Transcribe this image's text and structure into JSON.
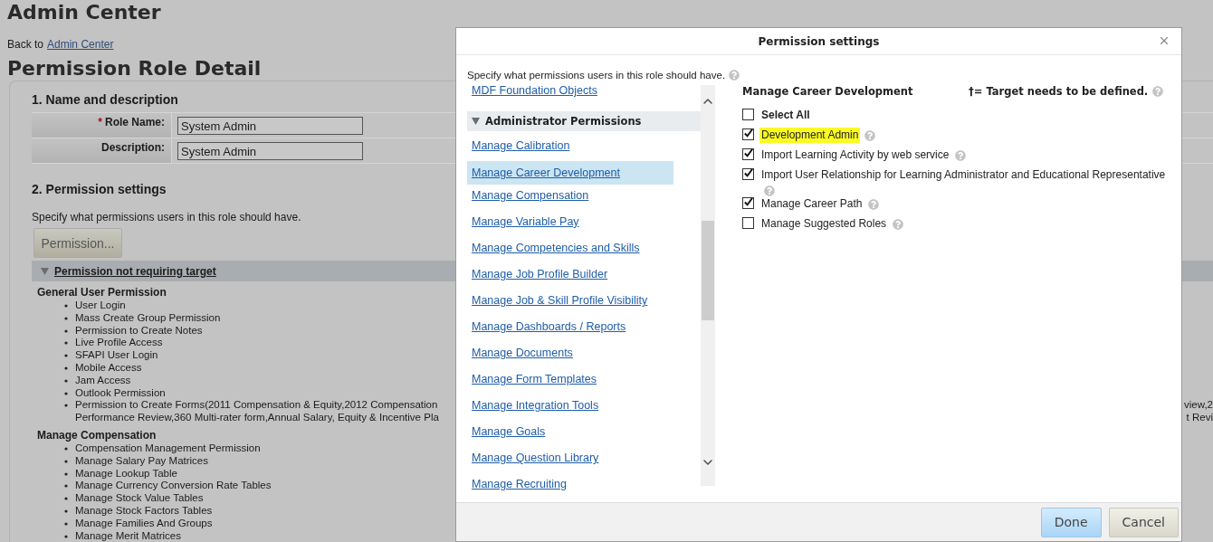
{
  "page": {
    "title": "Admin Center",
    "back_text": "Back to",
    "back_link": "Admin Center",
    "heading": "Permission Role Detail",
    "section1": {
      "title": "1. Name and description",
      "fields": [
        {
          "label": "Role Name:",
          "required_mark": "*",
          "value": "System Admin"
        },
        {
          "label": "Description:",
          "value": "System Admin"
        }
      ]
    },
    "section2": {
      "title": "2. Permission settings",
      "description": "Specify what permissions users in this role should have.",
      "button": "Permission...",
      "group": {
        "title": "Permission not requiring target",
        "expanded": true
      },
      "categories": [
        {
          "name": "General User Permission",
          "items": [
            {
              "lines": [
                {
                  "left": "User Login"
                }
              ]
            },
            {
              "lines": [
                {
                  "left": "Mass Create Group Permission"
                }
              ]
            },
            {
              "lines": [
                {
                  "left": "Permission to Create Notes"
                }
              ]
            },
            {
              "lines": [
                {
                  "left": "Live Profile Access"
                }
              ]
            },
            {
              "lines": [
                {
                  "left": "SFAPI User Login"
                }
              ]
            },
            {
              "lines": [
                {
                  "left": "Mobile Access"
                }
              ]
            },
            {
              "lines": [
                {
                  "left": "Jam Access"
                }
              ]
            },
            {
              "lines": [
                {
                  "left": "Outlook Permission"
                }
              ]
            },
            {
              "lines": [
                {
                  "left": "Permission to Create Forms(2011 Compensation & Equity,2012 Compensation",
                  "right": "view,2"
                },
                {
                  "left": "Performance Review,360 Multi-rater form,Annual Salary, Equity & Incentive Pla",
                  "right": "t Revi"
                }
              ]
            }
          ]
        },
        {
          "name": "Manage Compensation",
          "items": [
            {
              "lines": [
                {
                  "left": "Compensation Management Permission"
                }
              ]
            },
            {
              "lines": [
                {
                  "left": "Manage Salary Pay Matrices"
                }
              ]
            },
            {
              "lines": [
                {
                  "left": "Manage Lookup Table"
                }
              ]
            },
            {
              "lines": [
                {
                  "left": "Manage Currency Conversion Rate Tables"
                }
              ]
            },
            {
              "lines": [
                {
                  "left": "Manage Stock Value Tables"
                }
              ]
            },
            {
              "lines": [
                {
                  "left": "Manage Stock Factors Tables"
                }
              ]
            },
            {
              "lines": [
                {
                  "left": "Manage Families And Groups"
                }
              ]
            },
            {
              "lines": [
                {
                  "left": "Manage Merit Matrices"
                }
              ]
            }
          ]
        }
      ]
    }
  },
  "dialog": {
    "title": "Permission settings",
    "description": "Specify what permissions users in this role should have.",
    "nav": [
      {
        "kind": "link",
        "label": "MDF Foundation Objects",
        "selected": false
      },
      {
        "kind": "group",
        "label": "Administrator Permissions",
        "expanded": true
      },
      {
        "kind": "link",
        "label": "Manage Calibration",
        "selected": false
      },
      {
        "kind": "link",
        "label": "Manage Career Development",
        "selected": true
      },
      {
        "kind": "link",
        "label": "Manage Compensation",
        "selected": false
      },
      {
        "kind": "link",
        "label": "Manage Variable Pay",
        "selected": false
      },
      {
        "kind": "link",
        "label": "Manage Competencies and Skills",
        "selected": false
      },
      {
        "kind": "link",
        "label": "Manage Job Profile Builder",
        "selected": false
      },
      {
        "kind": "link",
        "label": "Manage Job & Skill Profile Visibility",
        "selected": false
      },
      {
        "kind": "link",
        "label": "Manage Dashboards / Reports",
        "selected": false
      },
      {
        "kind": "link",
        "label": "Manage Documents",
        "selected": false
      },
      {
        "kind": "link",
        "label": "Manage Form Templates",
        "selected": false
      },
      {
        "kind": "link",
        "label": "Manage Integration Tools",
        "selected": false
      },
      {
        "kind": "link",
        "label": "Manage Goals",
        "selected": false
      },
      {
        "kind": "link",
        "label": "Manage Question Library",
        "selected": false
      },
      {
        "kind": "link",
        "label": "Manage Recruiting",
        "selected": false
      }
    ],
    "detail": {
      "title": "Manage Career Development",
      "legend": "†= Target needs to be defined.",
      "options": [
        {
          "kind": "select_all",
          "label": "Select All",
          "checked": false,
          "highlighted": false,
          "help": false
        },
        {
          "kind": "permission",
          "label": "Development Admin",
          "checked": true,
          "highlighted": true,
          "help": true
        },
        {
          "kind": "permission",
          "label": "Import Learning Activity by web service",
          "checked": true,
          "highlighted": false,
          "help": true
        },
        {
          "kind": "permission",
          "label": "Import User Relationship for Learning Administrator and Educational Representative",
          "checked": true,
          "highlighted": false,
          "help": true
        },
        {
          "kind": "permission",
          "label": "Manage Career Path",
          "checked": true,
          "highlighted": false,
          "help": true
        },
        {
          "kind": "permission",
          "label": "Manage Suggested Roles",
          "checked": false,
          "highlighted": false,
          "help": true
        }
      ]
    },
    "buttons": [
      {
        "kind": "primary",
        "label": "Done"
      },
      {
        "kind": "secondary",
        "label": "Cancel"
      }
    ]
  }
}
